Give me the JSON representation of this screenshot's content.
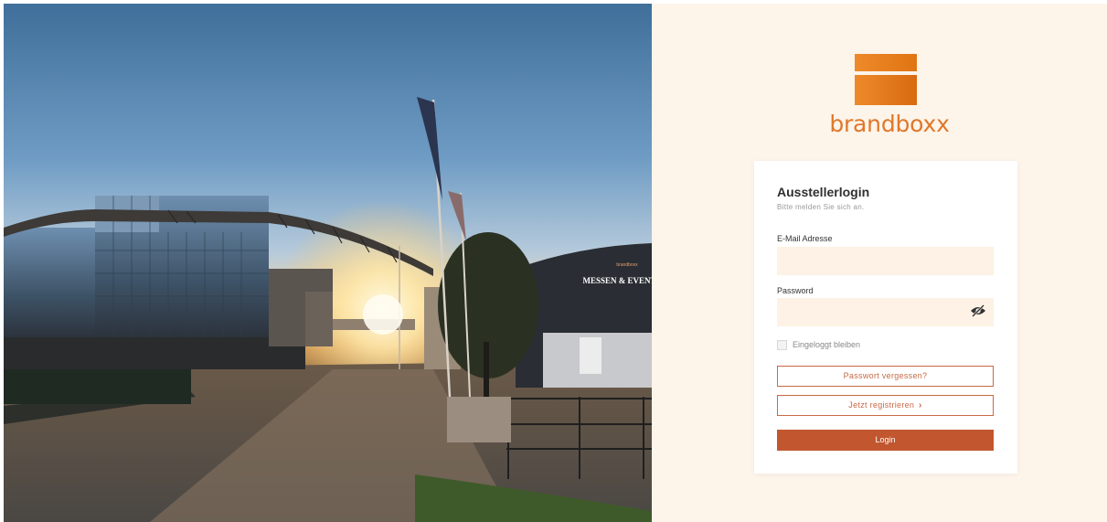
{
  "brand": {
    "name": "brandboxx",
    "accent": "#e0782a"
  },
  "photo": {
    "sign_small": "brandboxx",
    "sign_large": "MESSEN & EVENTS"
  },
  "login": {
    "title": "Ausstellerlogin",
    "subtitle": "Bitte melden Sie sich an.",
    "email_label": "E-Mail Adresse",
    "email_value": "",
    "password_label": "Password",
    "password_value": "",
    "remember_label": "Eingeloggt bleiben",
    "remember_checked": false,
    "forgot_label": "Passwort vergessen?",
    "register_label": "Jetzt registrieren",
    "register_icon": "chevron-right-icon",
    "password_toggle_icon": "eye-slash-icon",
    "login_label": "Login",
    "button_color": "#c1562f"
  }
}
